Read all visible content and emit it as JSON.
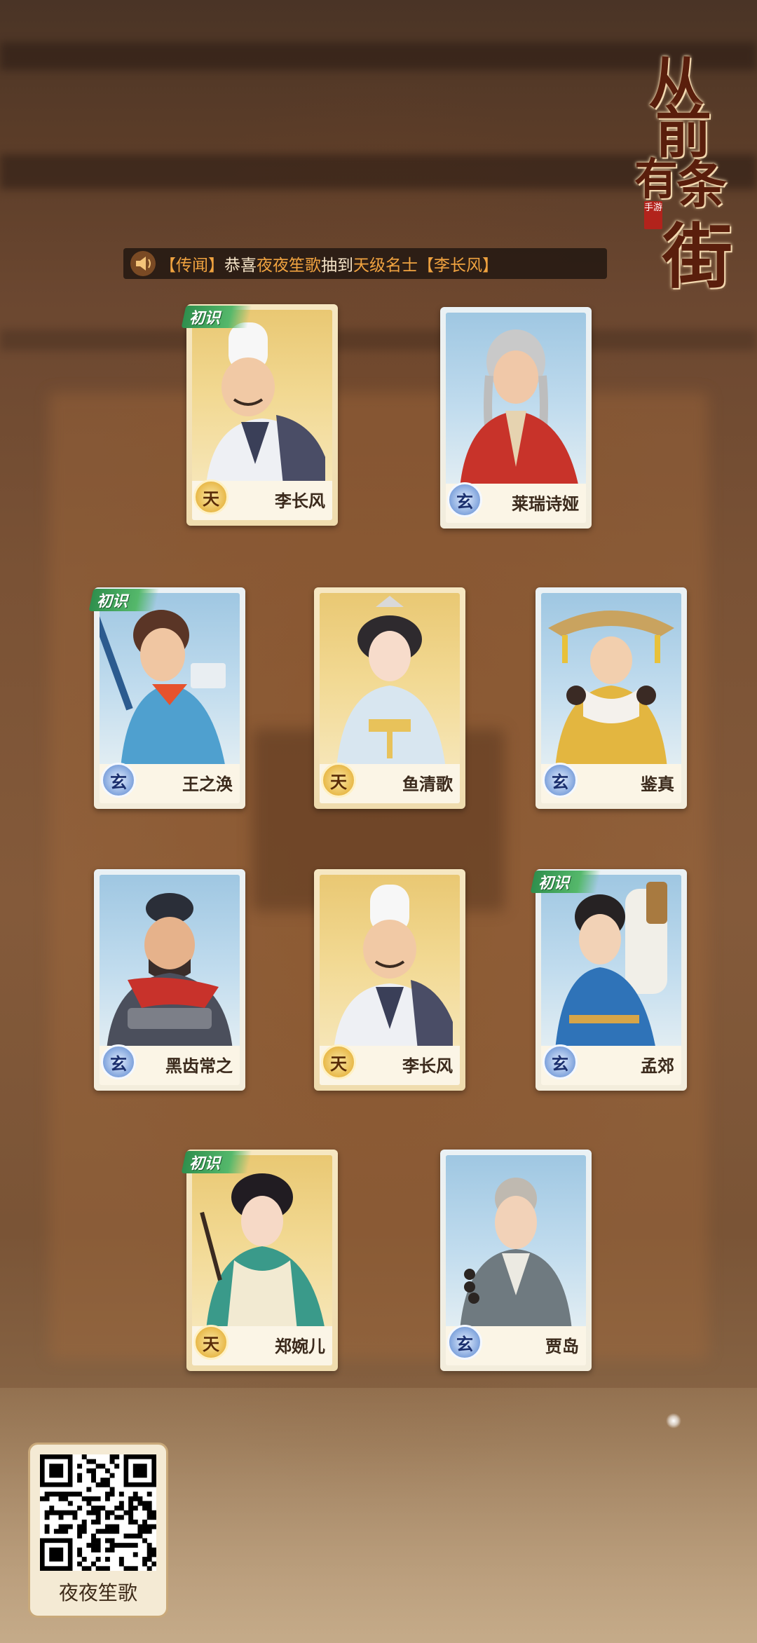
{
  "logo": {
    "title_chars": [
      "从",
      "前",
      "有",
      "条",
      "街"
    ],
    "seal_text": "手游"
  },
  "news": {
    "icon": "speaker-icon",
    "prefix": "【传闻】",
    "congrats": "恭喜",
    "player": "夜夜笙歌",
    "action": "抽到",
    "rarity": "天级名士",
    "character": "【李长风】"
  },
  "ribbon_text": "初识",
  "cards": [
    {
      "name": "李长风",
      "rank": "天",
      "rank_type": "tian",
      "new": true
    },
    {
      "name": "莱瑞诗娅",
      "rank": "玄",
      "rank_type": "xuan",
      "new": false
    },
    {
      "name": "王之涣",
      "rank": "玄",
      "rank_type": "xuan",
      "new": true
    },
    {
      "name": "鱼清歌",
      "rank": "天",
      "rank_type": "tian",
      "new": false
    },
    {
      "name": "鉴真",
      "rank": "玄",
      "rank_type": "xuan",
      "new": false
    },
    {
      "name": "黑齿常之",
      "rank": "玄",
      "rank_type": "xuan",
      "new": false
    },
    {
      "name": "李长风",
      "rank": "天",
      "rank_type": "tian",
      "new": false
    },
    {
      "name": "孟郊",
      "rank": "玄",
      "rank_type": "xuan",
      "new": true
    },
    {
      "name": "郑婉儿",
      "rank": "天",
      "rank_type": "tian",
      "new": true
    },
    {
      "name": "贾岛",
      "rank": "玄",
      "rank_type": "xuan",
      "new": false
    }
  ],
  "qr": {
    "label": "夜夜笙歌"
  },
  "colors": {
    "news_highlight": "#f0a340",
    "rank_tian": "#e8b94a",
    "rank_xuan": "#7fa3dc",
    "ribbon": "#3a9a55"
  }
}
